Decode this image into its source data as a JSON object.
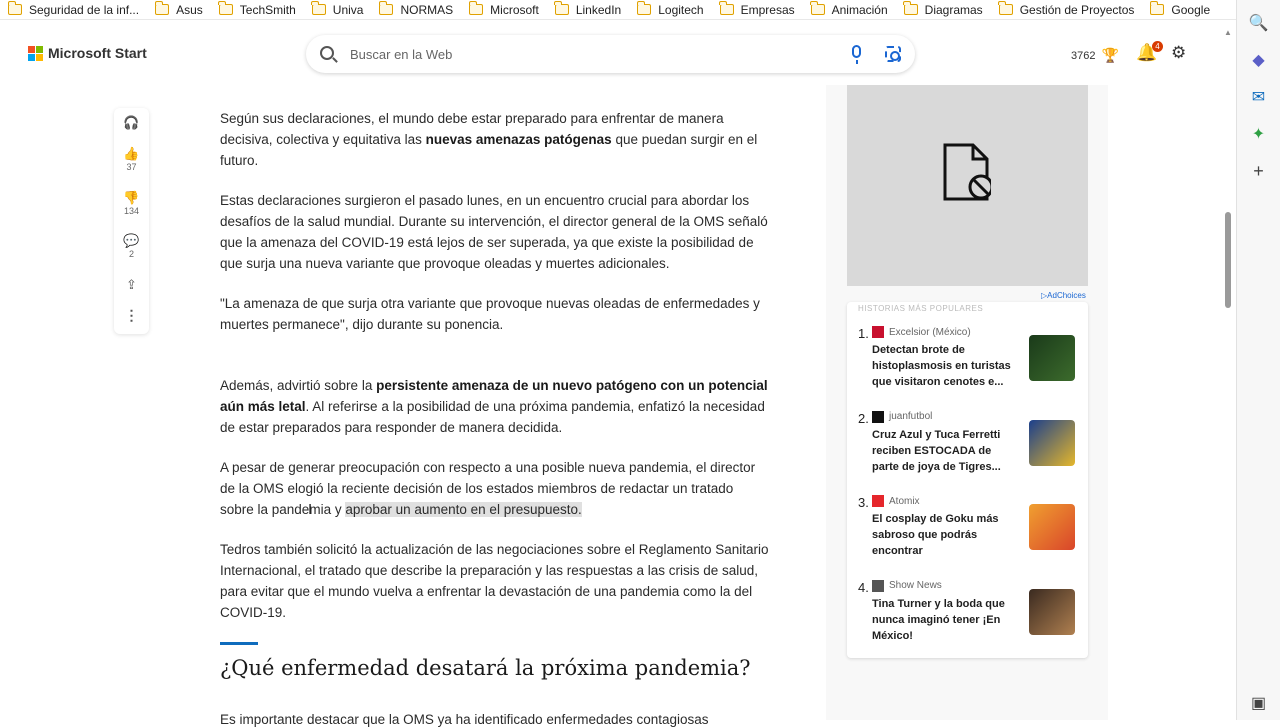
{
  "bookmarks": [
    "Seguridad de la inf...",
    "Asus",
    "TechSmith",
    "Univa",
    "NORMAS",
    "Microsoft",
    "LinkedIn",
    "Logitech",
    "Empresas",
    "Animación",
    "Diagramas",
    "Gestión de Proyectos",
    "Google"
  ],
  "header": {
    "logo_text": "Microsoft Start",
    "search_placeholder": "Buscar en la Web",
    "points": "3762",
    "notification_count": "4"
  },
  "rail": {
    "likes": "37",
    "dislikes": "134",
    "comments": "2"
  },
  "article": {
    "p1_a": "Según sus declaraciones, el mundo debe estar preparado para enfrentar de manera decisiva, colectiva y equitativa las ",
    "p1_b": "nuevas amenazas patógenas",
    "p1_c": " que puedan surgir en el futuro.",
    "p2": "Estas declaraciones surgieron el pasado lunes, en un encuentro crucial para abordar los desafíos de la salud mundial. Durante su intervención, el director general de la OMS señaló que la amenaza del COVID-19 está lejos de ser superada, ya que existe la posibilidad de que surja una nueva variante que provoque oleadas y muertes adicionales.",
    "p3": "\"La amenaza de que surja otra variante que provoque nuevas oleadas de enfermedades y muertes permanece\", dijo durante su ponencia.",
    "p4_a": "Además, advirtió sobre la ",
    "p4_b": "persistente amenaza de un nuevo patógeno con un potencial aún más letal",
    "p4_c": ". Al referirse a la posibilidad de una próxima pandemia, enfatizó la necesidad de estar preparados para responder de manera decidida.",
    "p5_a": "A pesar de generar preocupación con respecto a una posible nueva pandemia, el director de la OMS elogió la reciente decisión de los estados miembros de redactar un tratado sobre la pandemia y ",
    "p5_b": "aprobar un aumento en el presupuesto.",
    "p6": "Tedros también solicitó la actualización de las negociaciones sobre el Reglamento Sanitario Internacional, el tratado que describe la preparación y las respuestas a las crisis de salud, para evitar que el mundo vuelva a enfrentar la devastación de una pandemia como la del COVID-19.",
    "heading": "¿Qué enfermedad desatará la próxima pandemia?",
    "cut_line": "Es importante destacar que la OMS ya ha identificado enfermedades contagiosas"
  },
  "sidebar": {
    "adchoices": "AdChoices",
    "popular_heading": "HISTORIAS MÁS POPULARES",
    "stories": [
      {
        "num": "1.",
        "source": "Excelsior (México)",
        "title": "Detectan brote de histoplasmosis en turistas que visitaron cenotes e...",
        "color": "#c8102e"
      },
      {
        "num": "2.",
        "source": "juanfutbol",
        "title": "Cruz Azul y Tuca Ferretti reciben ESTOCADA de parte de joya de Tigres...",
        "color": "#111111"
      },
      {
        "num": "3.",
        "source": "Atomix",
        "title": "El cosplay de Goku más sabroso que podrás encontrar",
        "color": "#e5262b"
      },
      {
        "num": "4.",
        "source": "Show News",
        "title": "Tina Turner y la boda que nunca imaginó tener ¡En México!",
        "color": "#555555"
      }
    ]
  }
}
